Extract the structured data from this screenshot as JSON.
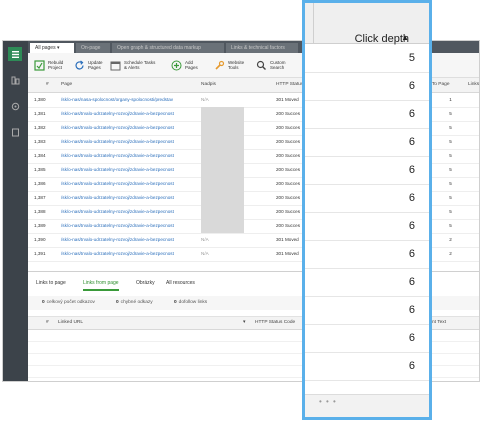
{
  "tabs": [
    "All pages",
    "On-page",
    "Open graph & structured data markup",
    "Links & technical factors"
  ],
  "toolbar": {
    "rebuild": "Rebuild\nProject",
    "update": "Update\nPages",
    "schedule": "Schedule Tasks\n& Alerts",
    "add": "Add\nPages",
    "website_tools": "Website\nTools",
    "custom_search": "Custom\nSearch"
  },
  "grid": {
    "headers": {
      "num": "#",
      "page": "Page",
      "nadpis": "Nadpis",
      "http": "HTTP Status",
      "links_to": "n To Page",
      "links": "Links"
    },
    "rows": [
      {
        "num": "1,380",
        "page": "/sk/o-nas/nasa-spolocnost/organy-spolocnosti/predstav",
        "nadpis": "N/A",
        "http": "301 Moved",
        "links": "1"
      },
      {
        "num": "1,381",
        "page": "/sk/o-nas/trvalo-udrzatelny-rozvoj/zdravie-a-bezpecnost",
        "nadpis": "",
        "http": "200 Succes",
        "links": "5"
      },
      {
        "num": "1,382",
        "page": "/sk/o-nas/trvalo-udrzatelny-rozvoj/zdravie-a-bezpecnost",
        "nadpis": "",
        "http": "200 Succes",
        "links": "5"
      },
      {
        "num": "1,383",
        "page": "/sk/o-nas/trvalo-udrzatelny-rozvoj/zdravie-a-bezpecnost",
        "nadpis": "",
        "http": "200 Succes",
        "links": "5"
      },
      {
        "num": "1,384",
        "page": "/sk/o-nas/trvalo-udrzatelny-rozvoj/zdravie-a-bezpecnost",
        "nadpis": "",
        "http": "200 Succes",
        "links": "5"
      },
      {
        "num": "1,385",
        "page": "/sk/o-nas/trvalo-udrzatelny-rozvoj/zdravie-a-bezpecnost",
        "nadpis": "",
        "http": "200 Succes",
        "links": "5"
      },
      {
        "num": "1,386",
        "page": "/sk/o-nas/trvalo-udrzatelny-rozvoj/zdravie-a-bezpecnost",
        "nadpis": "",
        "http": "200 Succes",
        "links": "5"
      },
      {
        "num": "1,387",
        "page": "/sk/o-nas/trvalo-udrzatelny-rozvoj/zdravie-a-bezpecnost",
        "nadpis": "",
        "http": "200 Succes",
        "links": "5"
      },
      {
        "num": "1,388",
        "page": "/sk/o-nas/trvalo-udrzatelny-rozvoj/zdravie-a-bezpecnost",
        "nadpis": "",
        "http": "200 Succes",
        "links": "5"
      },
      {
        "num": "1,389",
        "page": "/sk/o-nas/trvalo-udrzatelny-rozvoj/zdravie-a-bezpecnost",
        "nadpis": "",
        "http": "200 Succes",
        "links": "5"
      },
      {
        "num": "1,390",
        "page": "/sk/o-nas/trvalo-udrzatelny-rozvoj/zdravie-a-bezpecnost",
        "nadpis": "N/A",
        "http": "301 Moved",
        "links": "2"
      },
      {
        "num": "1,391",
        "page": "/sk/o-nas/trvalo-udrzatelny-rozvoj/zdravie-a-bezpecnost",
        "nadpis": "N/A",
        "http": "301 Moved",
        "links": "2"
      }
    ]
  },
  "bottom": {
    "tabs": [
      "Links to page",
      "Links from page",
      "Obrázky",
      "All resources"
    ],
    "counters": [
      {
        "count": "0",
        "label": "celkový počet odkazov"
      },
      {
        "count": "0",
        "label": "chybné odkazy"
      },
      {
        "count": "0",
        "label": "dofollow links"
      }
    ],
    "headers": {
      "num": "#",
      "linked_url": "Linked URL",
      "http": "HTTP Status Code",
      "anchor": "...nt Text"
    }
  },
  "popup": {
    "header": "Click depth",
    "sort_icon": "sort-ascending-icon",
    "values": [
      "5",
      "6",
      "6",
      "6",
      "6",
      "6",
      "6",
      "6",
      "6",
      "6",
      "6",
      "6"
    ],
    "footer": "• • •"
  },
  "colors": {
    "accent": "#5ab0ea",
    "link": "#2a6ebb",
    "active_tab": "#3a9a3a",
    "sidebar": "#3c434a"
  }
}
